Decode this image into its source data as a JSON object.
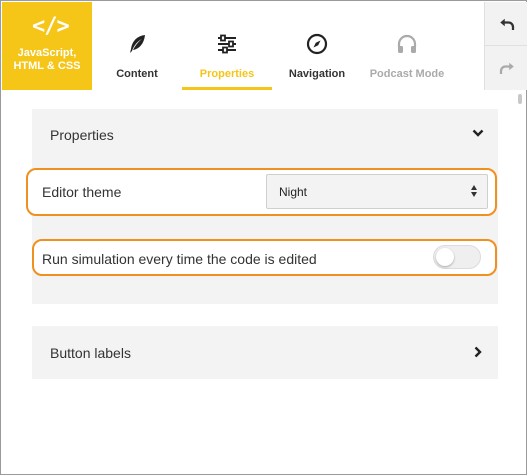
{
  "logo": {
    "icon": "code-icon",
    "line1": "JavaScript,",
    "line2": "HTML & CSS"
  },
  "tabs": [
    {
      "label": "Content",
      "icon": "feather-icon",
      "state": "normal"
    },
    {
      "label": "Properties",
      "icon": "sliders-icon",
      "state": "active"
    },
    {
      "label": "Navigation",
      "icon": "compass-icon",
      "state": "normal"
    },
    {
      "label": "Podcast Mode",
      "icon": "headphones-icon",
      "state": "disabled"
    }
  ],
  "toolbar": {
    "undo_icon": "undo-icon",
    "redo_icon": "redo-icon"
  },
  "properties_section": {
    "title": "Properties",
    "expanded": true,
    "editor_theme": {
      "label": "Editor theme",
      "value": "Night"
    },
    "run_simulation": {
      "label": "Run simulation every time the code is edited",
      "enabled": false
    }
  },
  "button_labels_section": {
    "title": "Button labels",
    "expanded": false
  },
  "colors": {
    "accent": "#f5c518",
    "highlight_border": "#f0901e",
    "panel_bg": "#f3f3f3"
  }
}
